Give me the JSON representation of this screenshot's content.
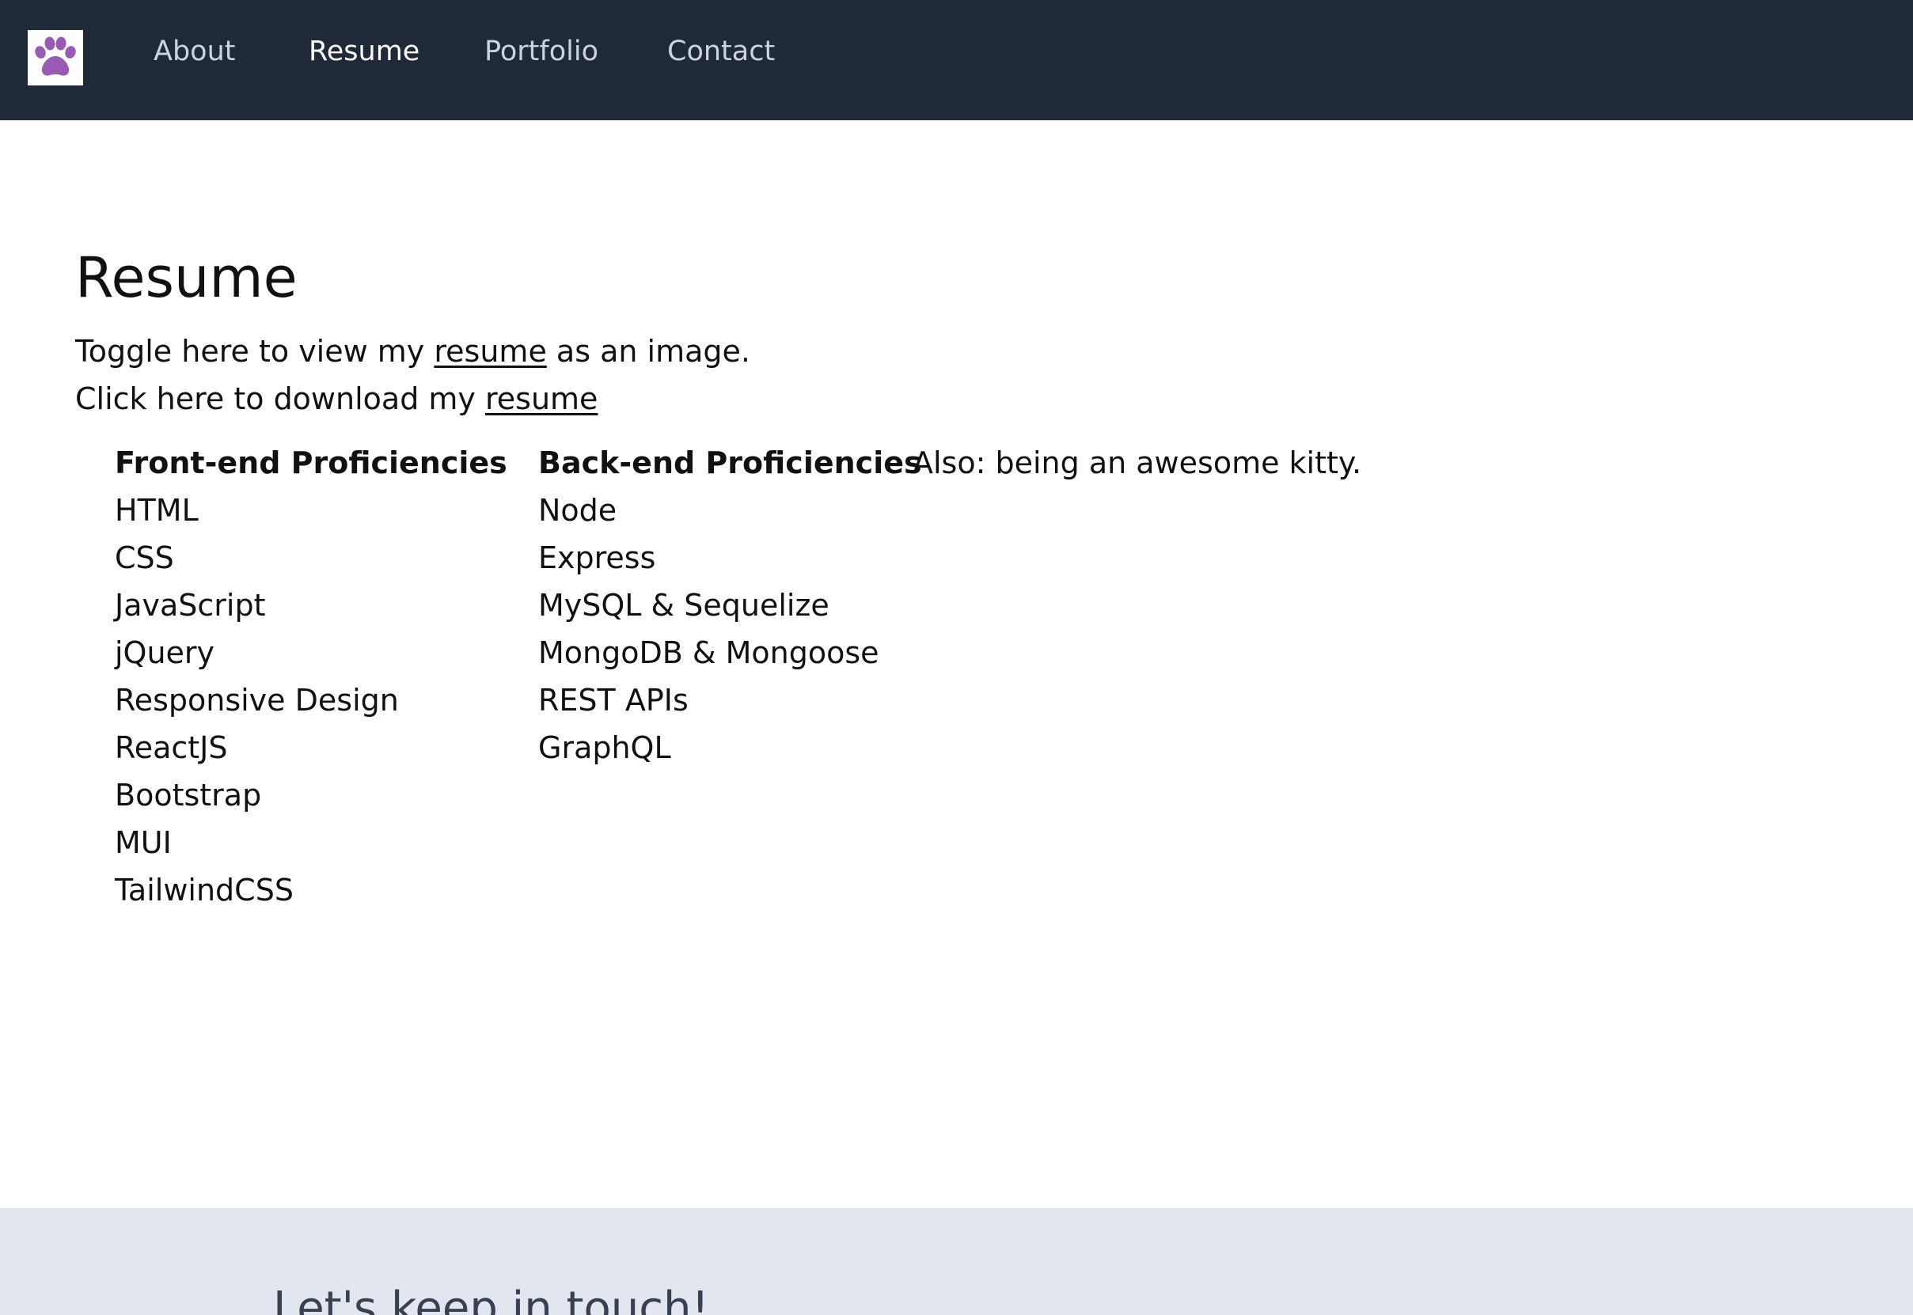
{
  "nav": {
    "logo_icon": "paw-icon",
    "logo_color": "#9b59b6",
    "background": "#1f2937",
    "links": [
      {
        "label": "About"
      },
      {
        "label": "Resume"
      },
      {
        "label": "Portfolio"
      },
      {
        "label": "Contact"
      }
    ],
    "active": "Resume"
  },
  "main": {
    "title": "Resume",
    "toggle_line": {
      "before": "Toggle here to view my ",
      "link": "resume",
      "after": " as an image."
    },
    "download_line": {
      "before": "Click here to download my ",
      "link": "resume"
    },
    "frontend": {
      "heading": "Front-end Proficiencies",
      "items": [
        "HTML",
        "CSS",
        "JavaScript",
        "jQuery",
        "Responsive Design",
        "ReactJS",
        "Bootstrap",
        "MUI",
        "TailwindCSS"
      ]
    },
    "backend": {
      "heading": "Back-end Proficiencies",
      "items": [
        "Node",
        "Express",
        "MySQL & Sequelize",
        "MongoDB & Mongoose",
        "REST APIs",
        "GraphQL"
      ]
    },
    "also": "Also: being an awesome kitty."
  },
  "footer": {
    "heading": "Let's keep in touch!",
    "background": "#e2e6ee"
  }
}
